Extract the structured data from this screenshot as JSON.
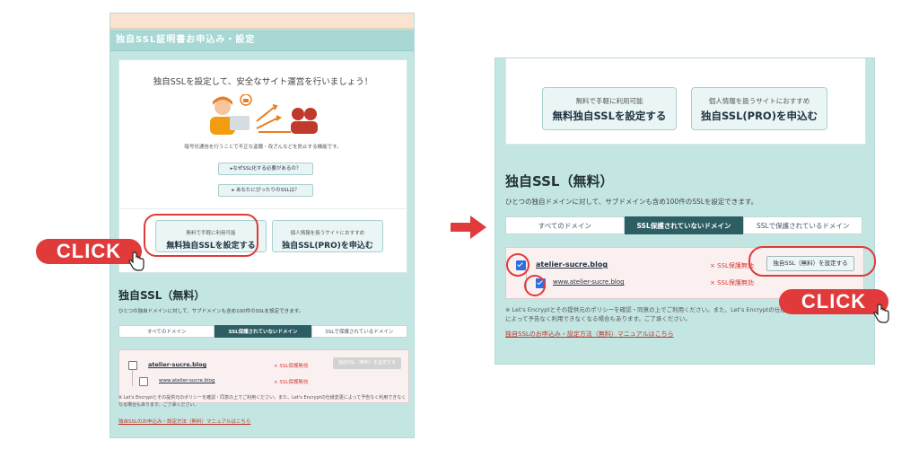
{
  "left": {
    "header": "独自SSL証明書お申込み・設定",
    "intro_title": "独自SSLを設定して、安全なサイト運営を行いましょう！",
    "intro_desc": "暗号化通信を行うことで不正な盗聴・改ざんなどを防止する機能です。",
    "why_button": "▸なぜSSL化する必要があるの？",
    "which_button": "▸ あなたにぴったりのSSLは？",
    "free_btn": {
      "small": "無料で手軽に利用可能",
      "big": "無料独自SSLを設定する"
    },
    "pro_btn": {
      "small": "個人情報を扱うサイトにおすすめ",
      "big": "独自SSL(PRO)を申込む"
    },
    "section_title": "独自SSL（無料）",
    "section_sub": "ひとつの独自ドメインに対して、サブドメインも含め100件のSSLを設定できます。",
    "tabs": [
      "すべてのドメイン",
      "SSL保護されていないドメイン",
      "SSLで保護されているドメイン"
    ],
    "domain": "atelier-sucre.blog",
    "subdomain": "www.atelier-sucre.blog",
    "status": "× SSL保護無効",
    "set_button": "独自SSL（無料）を設定する",
    "note": "※ Let's Encryptとその提供元のポリシーを確認・同意の上でご利用ください。また、Let's Encryptの仕様変更によって予告なく利用できなくなる場合もあります。ご了承ください。",
    "manual": "独自SSLのお申込み・設定方法（無料）マニュアルはこちら"
  },
  "right": {
    "free_btn": {
      "small": "無料で手軽に利用可能",
      "big": "無料独自SSLを設定する"
    },
    "pro_btn": {
      "small": "個人情報を扱うサイトにおすすめ",
      "big": "独自SSL(PRO)を申込む"
    },
    "section_title": "独自SSL（無料）",
    "section_sub": "ひとつの独自ドメインに対して、サブドメインも含め100件のSSLを設定できます。",
    "tabs": [
      "すべてのドメイン",
      "SSL保護されていないドメイン",
      "SSLで保護されているドメイン"
    ],
    "domain": "atelier-sucre.blog",
    "subdomain": "www.atelier-sucre.blog",
    "status": "× SSL保護無効",
    "set_button": "独自SSL（無料）を設定する",
    "note": "※ Let's Encryptとその提供元のポリシーを確認・同意の上でご利用ください。また、Let's Encryptの仕様変更によって予告なく利用できなくなる場合もあります。ご了承ください。",
    "manual": "独自SSLのお申込み・設定方法（無料）マニュアルはこちら"
  },
  "click_label": "CLICK",
  "colors": {
    "accent_red": "#e03a3a",
    "panel_bg": "#c3e6e3",
    "active_tab": "#2d5e63",
    "checkbox_blue": "#2f6fe0"
  }
}
